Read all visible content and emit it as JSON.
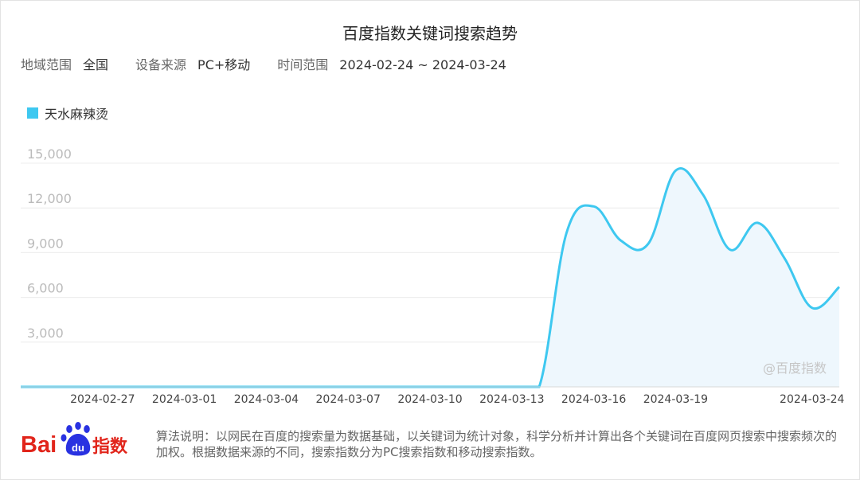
{
  "header": {
    "title": "百度指数关键词搜索趋势"
  },
  "filters": {
    "region_label": "地域范围",
    "region_value": "全国",
    "device_label": "设备来源",
    "device_value": "PC+移动",
    "time_label": "时间范围",
    "time_value": "2024-02-24 ~ 2024-03-24"
  },
  "legend": {
    "label": "天水麻辣烫"
  },
  "colors": {
    "line": "#3ec8f0",
    "fill": "#eef7fd",
    "brand_red": "#e1251b",
    "brand_blue": "#2932e1"
  },
  "watermark": "@百度指数",
  "footer": {
    "brand_text": "Bai",
    "brand_paw_text": "du",
    "brand_suffix": "指数",
    "note": "算法说明：以网民在百度的搜索量为数据基础，以关键词为统计对象，科学分析并计算出各个关键词在百度网页搜索中搜索频次的加权。根据数据来源的不同，搜索指数分为PC搜索指数和移动搜索指数。"
  },
  "chart_data": {
    "type": "area",
    "title": "百度指数关键词搜索趋势",
    "xlabel": "",
    "ylabel": "",
    "ylim": [
      0,
      16000
    ],
    "yticks": [
      3000,
      6000,
      9000,
      12000,
      15000
    ],
    "ytick_labels": [
      "3,000",
      "6,000",
      "9,000",
      "12,000",
      "15,000"
    ],
    "xtick_labels": [
      "2024-02-27",
      "2024-03-01",
      "2024-03-04",
      "2024-03-07",
      "2024-03-10",
      "2024-03-13",
      "2024-03-16",
      "2024-03-19",
      "2024-03-24"
    ],
    "grid": true,
    "legend_position": "top-left",
    "x": [
      "2024-02-24",
      "2024-02-25",
      "2024-02-26",
      "2024-02-27",
      "2024-02-28",
      "2024-02-29",
      "2024-03-01",
      "2024-03-02",
      "2024-03-03",
      "2024-03-04",
      "2024-03-05",
      "2024-03-06",
      "2024-03-07",
      "2024-03-08",
      "2024-03-09",
      "2024-03-10",
      "2024-03-11",
      "2024-03-12",
      "2024-03-13",
      "2024-03-14",
      "2024-03-15",
      "2024-03-16",
      "2024-03-17",
      "2024-03-18",
      "2024-03-19",
      "2024-03-20",
      "2024-03-21",
      "2024-03-22",
      "2024-03-23",
      "2024-03-24"
    ],
    "series": [
      {
        "name": "天水麻辣烫",
        "values": [
          0,
          0,
          0,
          0,
          0,
          0,
          0,
          0,
          0,
          0,
          0,
          0,
          0,
          0,
          0,
          0,
          0,
          0,
          0,
          0,
          10300,
          12100,
          9800,
          9600,
          14500,
          12900,
          9200,
          11000,
          8600,
          5300,
          6700
        ]
      }
    ]
  }
}
